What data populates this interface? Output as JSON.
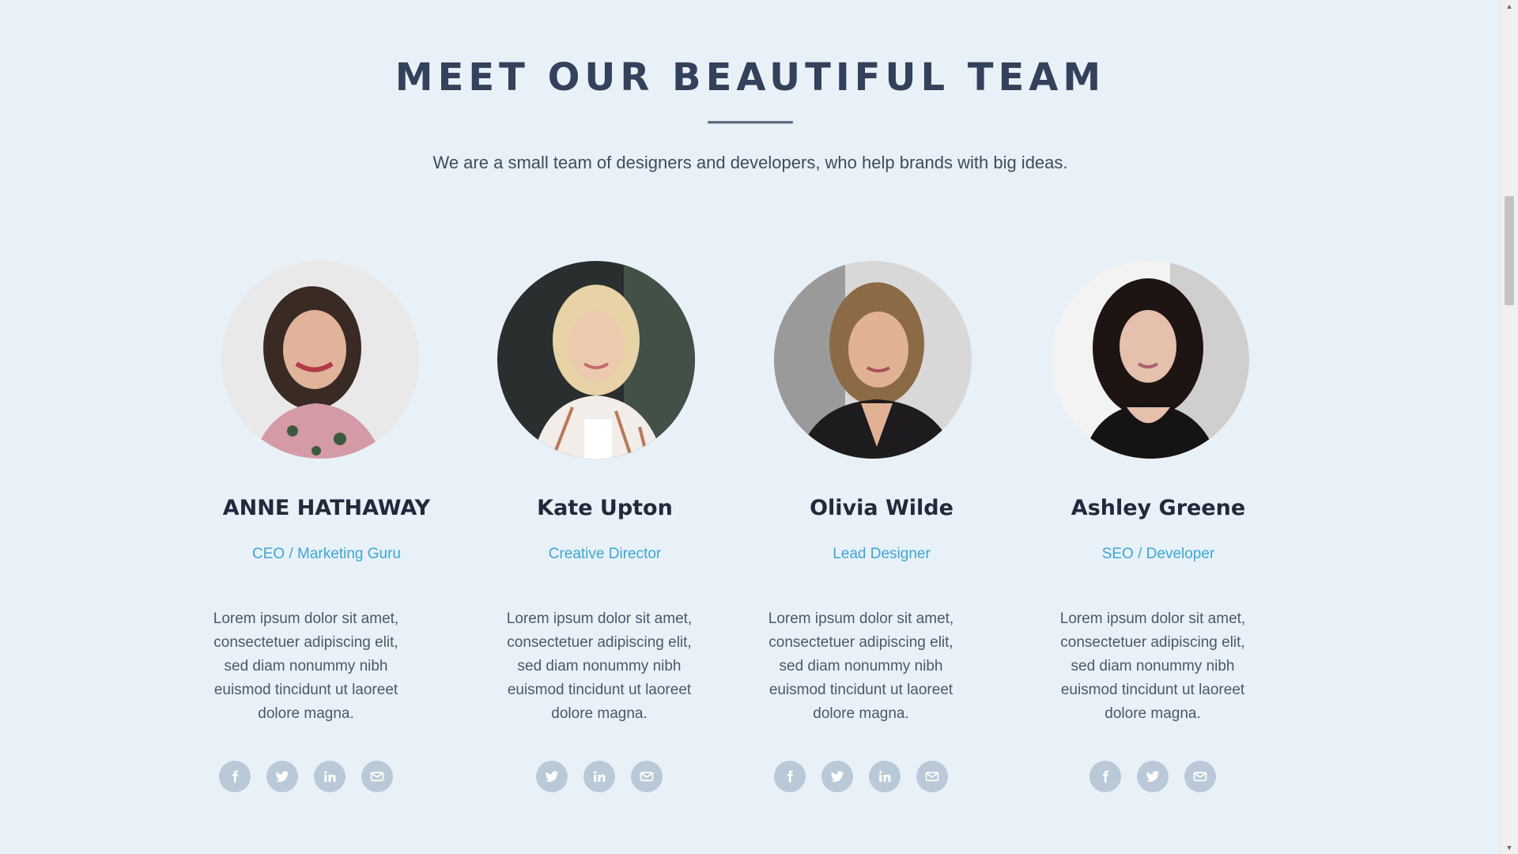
{
  "section": {
    "title": "MEET OUR BEAUTIFUL TEAM",
    "subtitle": "We are a small team of designers and developers, who help brands with big ideas."
  },
  "members": [
    {
      "name": "ANNE HATHAWAY",
      "role": "CEO / Marketing Guru",
      "bio": "Lorem ipsum dolor sit amet, consectetuer adipiscing elit, sed diam nonummy nibh euismod tincidunt ut laoreet dolore magna.",
      "socials": [
        "facebook-icon",
        "twitter-icon",
        "linkedin-icon",
        "email-icon"
      ]
    },
    {
      "name": "Kate Upton",
      "role": "Creative Director",
      "bio": "Lorem ipsum dolor sit amet, consectetuer adipiscing elit, sed diam nonummy nibh euismod tincidunt ut laoreet dolore magna.",
      "socials": [
        "twitter-icon",
        "linkedin-icon",
        "email-icon"
      ]
    },
    {
      "name": "Olivia Wilde",
      "role": "Lead Designer",
      "bio": "Lorem ipsum dolor sit amet, consectetuer adipiscing elit, sed diam nonummy nibh euismod tincidunt ut laoreet dolore magna.",
      "socials": [
        "facebook-icon",
        "twitter-icon",
        "linkedin-icon",
        "email-icon"
      ]
    },
    {
      "name": "Ashley Greene",
      "role": "SEO / Developer",
      "bio": "Lorem ipsum dolor sit amet, consectetuer adipiscing elit, sed diam nonummy nibh euismod tincidunt ut laoreet dolore magna.",
      "socials": [
        "facebook-icon",
        "twitter-icon",
        "email-icon"
      ]
    }
  ],
  "colors": {
    "background": "#e8f1f8",
    "heading": "#33415a",
    "role_accent": "#3ea6d2",
    "social_icon_bg": "#bac9d7"
  }
}
